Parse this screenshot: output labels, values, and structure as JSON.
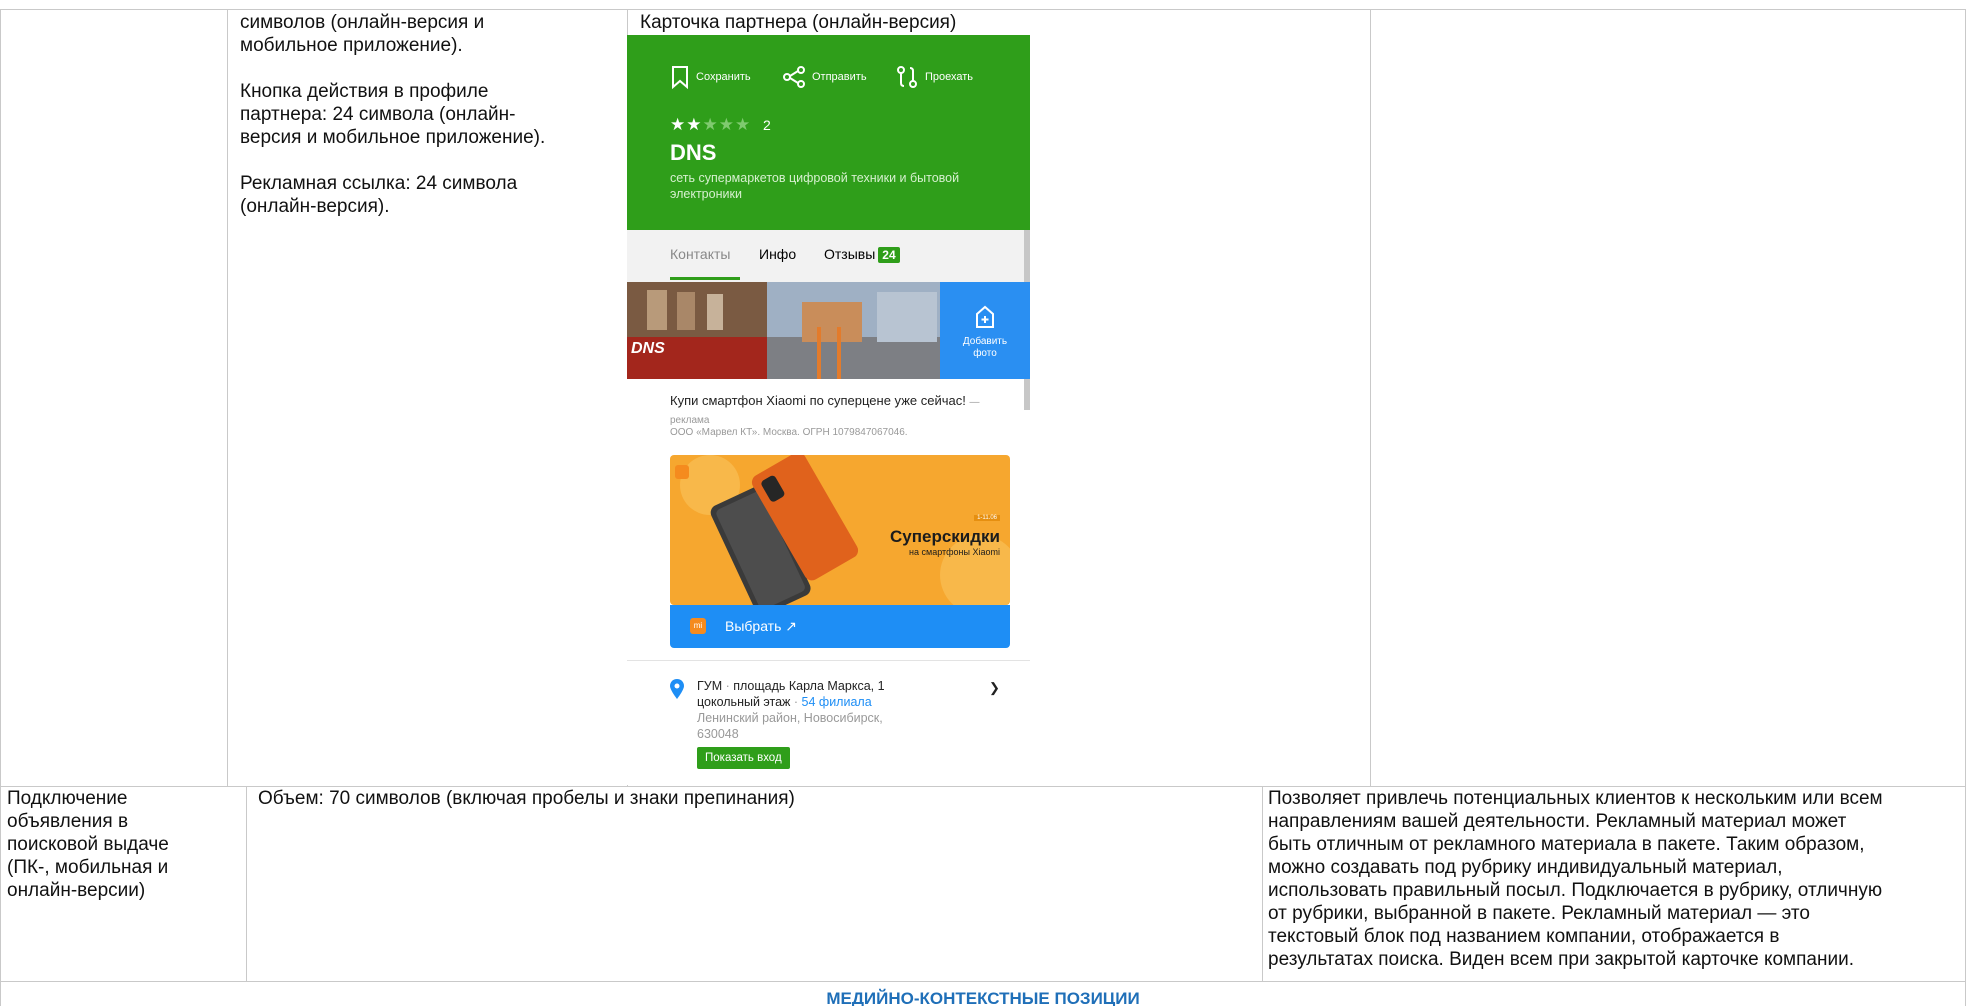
{
  "row1": {
    "col2_paragraphs": [
      [
        "символов (онлайн-версия и",
        "мобильное приложение)."
      ],
      [
        "Кнопка действия в профиле",
        "партнера: 24 символа (онлайн-",
        "версия и мобильное приложение)."
      ],
      [
        "Рекламная ссылка: 24 символа",
        "(онлайн-версия)."
      ]
    ],
    "col3_caption": "Карточка партнера (онлайн-версия)"
  },
  "phone": {
    "actions": [
      "Сохранить",
      "Отправить",
      "Проехать"
    ],
    "rating_stars": 2,
    "rating_max": 5,
    "rating_count": "2",
    "company_name": "DNS",
    "company_desc": "сеть супермаркетов цифровой техники и бытовой электроники",
    "tabs": [
      "Контакты",
      "Инфо",
      "Отзывы"
    ],
    "reviews_badge": "24",
    "store_sign": "DNS",
    "add_photo_label": "Добавить фото",
    "ad_title": "Купи смартфон Xiaomi по суперцене уже сейчас!",
    "ad_marker": "— реклама",
    "ad_legal": "ООО «Марвел КТ». Москва. ОГРН 1079847067046.",
    "promo_tag": "1-11.06",
    "promo_main": "Суперскидки",
    "promo_sub": "на смартфоны Xiaomi",
    "mi_logo": "mi",
    "select_button": "Выбрать ↗",
    "address_main": "ГУМ",
    "address_sep": " · ",
    "address_street": "площадь Карла Маркса, 1",
    "address_floor": "цокольный этаж",
    "address_branches": "54 филиала",
    "address_district": "Ленинский район, Новосибирск,",
    "address_zip": "630048",
    "show_entry_button": "Показать вход"
  },
  "row2": {
    "col1_lines": [
      "Подключение",
      "объявления в",
      "поисковой выдаче",
      "(ПК-, мобильная и",
      "онлайн-версии)"
    ],
    "col2_text": "Объем: 70 символов (включая пробелы и знаки препинания)",
    "col3_lines": [
      "Позволяет привлечь потенциальных клиентов к нескольким или всем",
      "направлениям вашей деятельности. Рекламный материал может",
      "быть отличным от рекламного материала в пакете. Таким образом,",
      "можно создавать под рубрику индивидуальный материал,",
      "использовать правильный посыл. Подключается в рубрику, отличную",
      "от рубрики, выбранной в пакете. Рекламный материал —  это",
      "текстовый блок под названием компании, отображается в",
      "результатах поиска. Виден всем при закрытой карточке компании."
    ]
  },
  "section_heading": "МЕДИЙНО-КОНТЕКСТНЫЕ ПОЗИЦИИ",
  "colors": {
    "brand_green": "#2f9e1a",
    "action_blue": "#1e8ef5",
    "heading_blue": "#1f6fb8",
    "promo_orange": "#f6a72f"
  }
}
